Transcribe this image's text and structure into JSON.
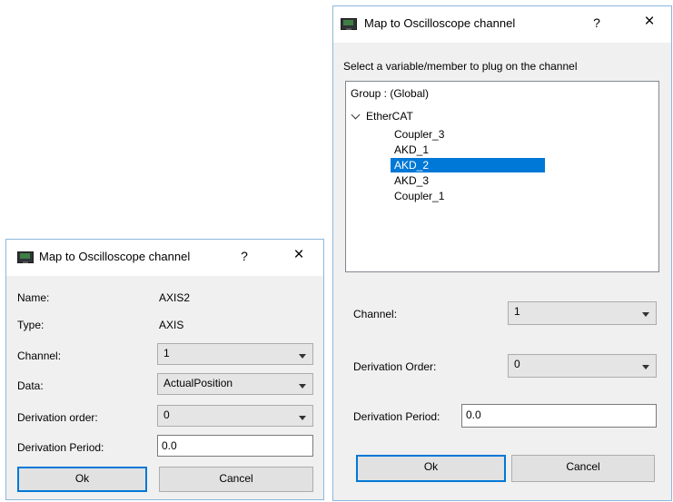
{
  "dialog_small": {
    "title": "Map to Oscilloscope channel",
    "help": "?",
    "close": "×",
    "name_label": "Name:",
    "name_value": "AXIS2",
    "type_label": "Type:",
    "type_value": "AXIS",
    "channel_label": "Channel:",
    "channel_value": "1",
    "data_label": "Data:",
    "data_value": "ActualPosition",
    "derivation_order_label": "Derivation order:",
    "derivation_order_value": "0",
    "derivation_period_label": "Derivation Period:",
    "derivation_period_value": "0.0",
    "ok_label": "Ok",
    "cancel_label": "Cancel"
  },
  "dialog_large": {
    "title": "Map to Oscilloscope channel",
    "help": "?",
    "close": "×",
    "instruction": "Select a variable/member to plug on the channel",
    "tree": {
      "group_label": "Group : (Global)",
      "root_label": "EtherCAT",
      "items": [
        {
          "label": "Coupler_3",
          "selected": false
        },
        {
          "label": "AKD_1",
          "selected": false
        },
        {
          "label": "AKD_2",
          "selected": true
        },
        {
          "label": "AKD_3",
          "selected": false
        },
        {
          "label": "Coupler_1",
          "selected": false
        }
      ]
    },
    "channel_label": "Channel:",
    "channel_value": "1",
    "derivation_order_label": "Derivation Order:",
    "derivation_order_value": "0",
    "derivation_period_label": "Derivation Period:",
    "derivation_period_value": "0.0",
    "ok_label": "Ok",
    "cancel_label": "Cancel"
  },
  "colors": {
    "accent": "#0078d7",
    "dialog_bg": "#f0f0f0",
    "border": "#8bb8de"
  }
}
